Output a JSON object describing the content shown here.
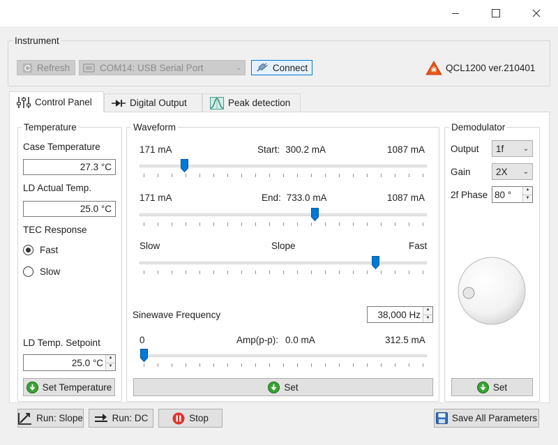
{
  "window": {
    "minimize_icon": "minimize-icon",
    "maximize_icon": "maximize-icon",
    "close_icon": "close-icon"
  },
  "instrument": {
    "group_title": "Instrument",
    "refresh_label": "Refresh",
    "port_value": "COM14: USB Serial Port",
    "connect_label": "Connect",
    "product_label": "QCL1200 ver.210401",
    "brand_color": "#e8561a"
  },
  "tabs": [
    {
      "label": "Control Panel",
      "icon": "sliders-icon"
    },
    {
      "label": "Digital Output",
      "icon": "diode-icon"
    },
    {
      "label": "Peak detection",
      "icon": "peak-icon"
    }
  ],
  "temperature": {
    "group_title": "Temperature",
    "case_label": "Case Temperature",
    "case_value": "27.3 °C",
    "ld_actual_label": "LD Actual Temp.",
    "ld_actual_value": "25.0 °C",
    "tec_label": "TEC Response",
    "tec_options": [
      {
        "label": "Fast",
        "selected": true
      },
      {
        "label": "Slow",
        "selected": false
      }
    ],
    "setpoint_label": "LD Temp. Setpoint",
    "setpoint_value": "25.0 °C",
    "set_button": "Set Temperature"
  },
  "waveform": {
    "group_title": "Waveform",
    "start": {
      "min_label": "171 mA",
      "label": "Start:",
      "value": "300.2 mA",
      "max_label": "1087 mA",
      "fraction": 0.146
    },
    "end": {
      "min_label": "171 mA",
      "label": "End:",
      "value": "733.0 mA",
      "max_label": "1087 mA",
      "fraction": 0.614
    },
    "slope": {
      "min_label": "Slow",
      "label": "Slope",
      "max_label": "Fast",
      "fraction": 0.831
    },
    "sine_label": "Sinewave Frequency",
    "sine_value": "38,000 Hz",
    "amp": {
      "min_label": "0",
      "label": "Amp(p-p):",
      "value": "0.0 mA",
      "max_label": "312.5 mA",
      "fraction": 0.0
    },
    "set_button": "Set"
  },
  "demodulator": {
    "group_title": "Demodulator",
    "output_label": "Output",
    "output_value": "1f",
    "gain_label": "Gain",
    "gain_value": "2X",
    "phase_label": "2f Phase",
    "phase_value": "80 °",
    "set_button": "Set"
  },
  "bottom": {
    "run_slope": "Run: Slope",
    "run_dc": "Run: DC",
    "stop": "Stop",
    "save": "Save All Parameters"
  },
  "colors": {
    "accent": "#0078d7",
    "green": "#3aa335",
    "stop_red": "#e2312a"
  }
}
